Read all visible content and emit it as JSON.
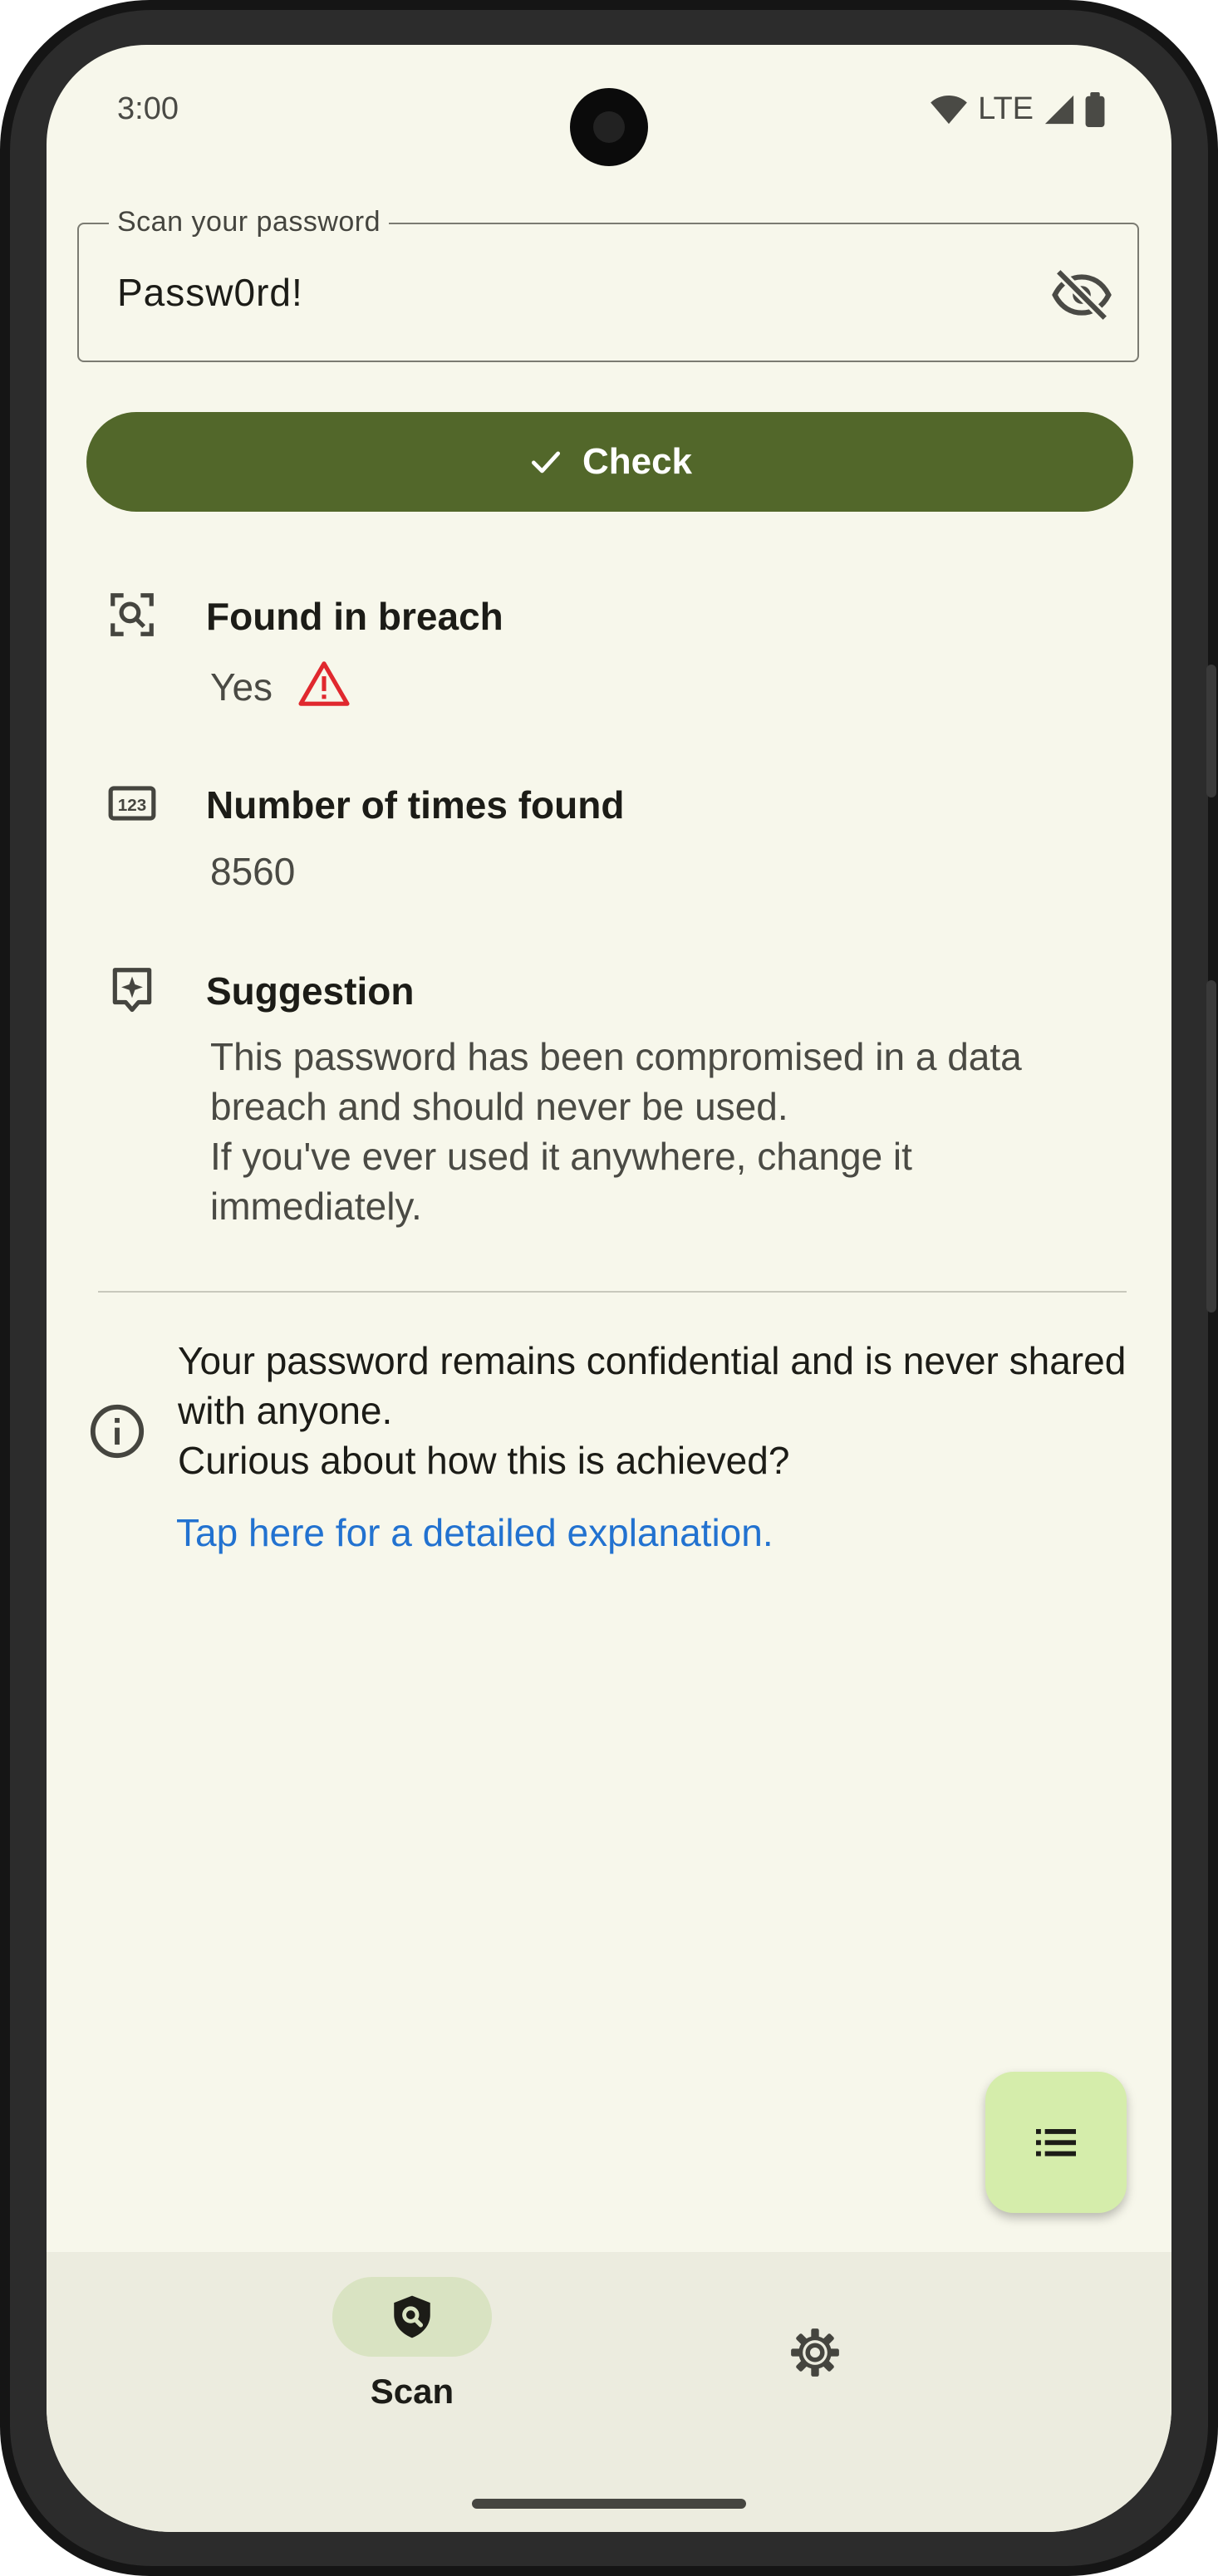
{
  "status_bar": {
    "time": "3:00",
    "network": "LTE"
  },
  "password_field": {
    "label": "Scan your password",
    "value": "Passw0rd!",
    "visibility_icon": "eye-off-icon"
  },
  "check_button": {
    "label": "Check",
    "icon": "check-icon"
  },
  "results": {
    "found_in_breach": {
      "title": "Found in breach",
      "value": "Yes",
      "icon": "scan-search-icon",
      "warning_icon": "warning-triangle-icon"
    },
    "times_found": {
      "title": "Number of times found",
      "value": "8560",
      "icon": "numbers-123-icon"
    },
    "suggestion": {
      "title": "Suggestion",
      "text": "This password has been compromised in a data breach and should never be used.\nIf you've ever used it anywhere, change it immediately.",
      "icon": "sparkle-feedback-icon"
    }
  },
  "info": {
    "text": "Your password remains confidential and is never shared with anyone.\nCurious about how this is achieved?",
    "link": "Tap here for a detailed explanation.",
    "icon": "info-icon"
  },
  "fab": {
    "icon": "list-icon"
  },
  "bottom_nav": {
    "items": [
      {
        "label": "Scan",
        "icon": "shield-search-icon",
        "selected": true
      },
      {
        "label": "",
        "icon": "gear-icon",
        "selected": false
      }
    ]
  },
  "colors": {
    "background": "#f7f7eb",
    "primary": "#52672a",
    "fab": "#d5edab",
    "nav_bg": "#ececdf",
    "nav_pill": "#d9e3c2",
    "link": "#2272d0",
    "warning": "#e0282e"
  }
}
